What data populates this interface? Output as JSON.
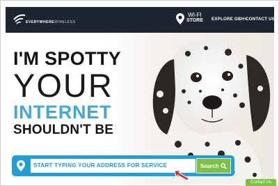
{
  "header": {
    "brand": {
      "line1": "EVERYWHERE",
      "line2": "WIRELESS"
    },
    "wifi_store": {
      "line1": "WI-FI",
      "line2": "STORE"
    },
    "nav": [
      {
        "label": "EXPLORE GBH+"
      },
      {
        "label": "CONTACT US"
      }
    ]
  },
  "hero": {
    "headline": {
      "line1": "I'M SPOTTY",
      "line2": "YOUR",
      "line3": "INTERNET",
      "line4": "SHOULDN'T BE"
    },
    "search": {
      "placeholder": "START TYPING YOUR ADDRESS FOR SERVICE",
      "button_label": "Search"
    }
  },
  "contact_tab": {
    "label": "Contact Us"
  },
  "colors": {
    "header_bg": "#1c2530",
    "accent_blue": "#1e9fd7",
    "accent_green": "#7cc242",
    "internet_blue": "#43a8d8"
  },
  "icons": [
    "wifi-logo-icon",
    "location-pin-icon",
    "search-icon",
    "cursor-arrow-icon"
  ]
}
